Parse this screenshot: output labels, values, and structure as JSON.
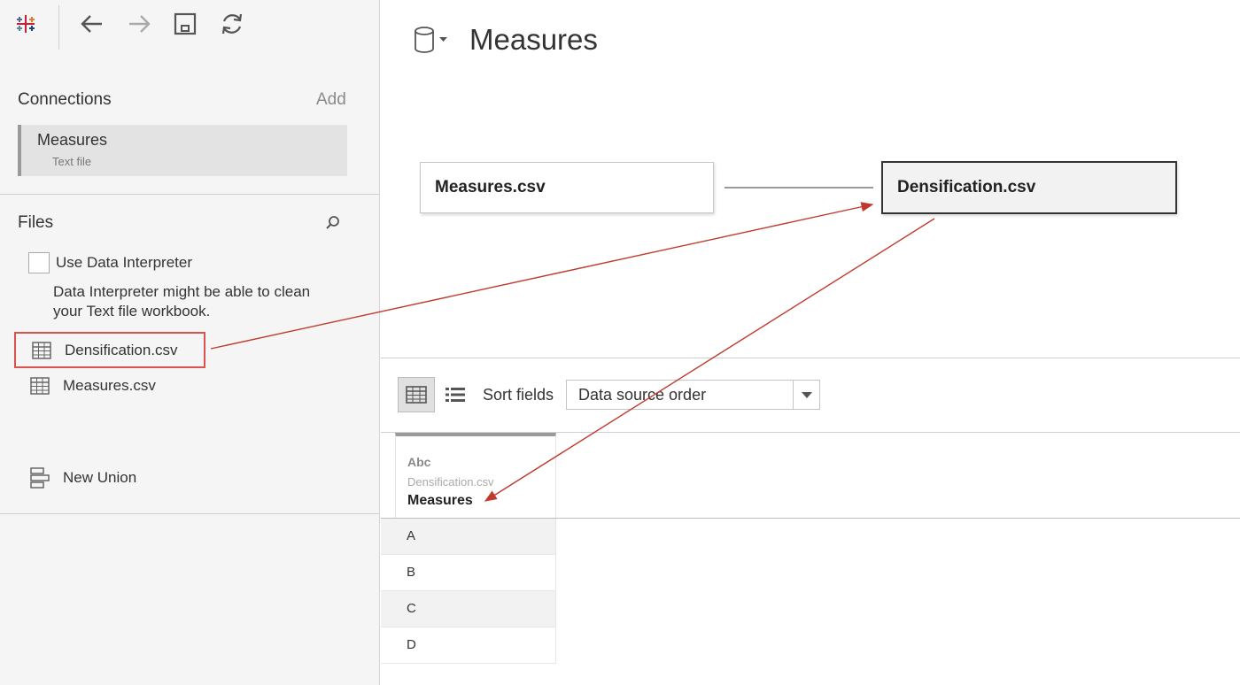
{
  "toolbar": {
    "icons": [
      "tableau-logo-icon",
      "back-arrow-icon",
      "forward-arrow-icon",
      "save-icon",
      "refresh-icon"
    ]
  },
  "connections": {
    "title": "Connections",
    "add_label": "Add",
    "items": [
      {
        "name": "Measures",
        "type": "Text file"
      }
    ]
  },
  "files": {
    "title": "Files",
    "use_interpreter_label": "Use Data Interpreter",
    "interpreter_note": "Data Interpreter might be able to clean your Text file workbook.",
    "items": [
      {
        "label": "Densification.csv",
        "highlighted": true
      },
      {
        "label": "Measures.csv",
        "highlighted": false
      }
    ],
    "new_union_label": "New Union"
  },
  "canvas": {
    "datasource_title": "Measures",
    "tables": [
      {
        "label": "Measures.csv"
      },
      {
        "label": "Densification.csv"
      }
    ]
  },
  "grid_toolbar": {
    "sort_label": "Sort fields",
    "sort_value": "Data source order"
  },
  "grid": {
    "column": {
      "type": "Abc",
      "source": "Densification.csv",
      "name": "Measures"
    },
    "rows": [
      "A",
      "B",
      "C",
      "D"
    ]
  },
  "colors": {
    "highlight_red": "#d9534f",
    "arrow_red": "#c0392b",
    "sidebar_bg": "#f5f5f5"
  }
}
